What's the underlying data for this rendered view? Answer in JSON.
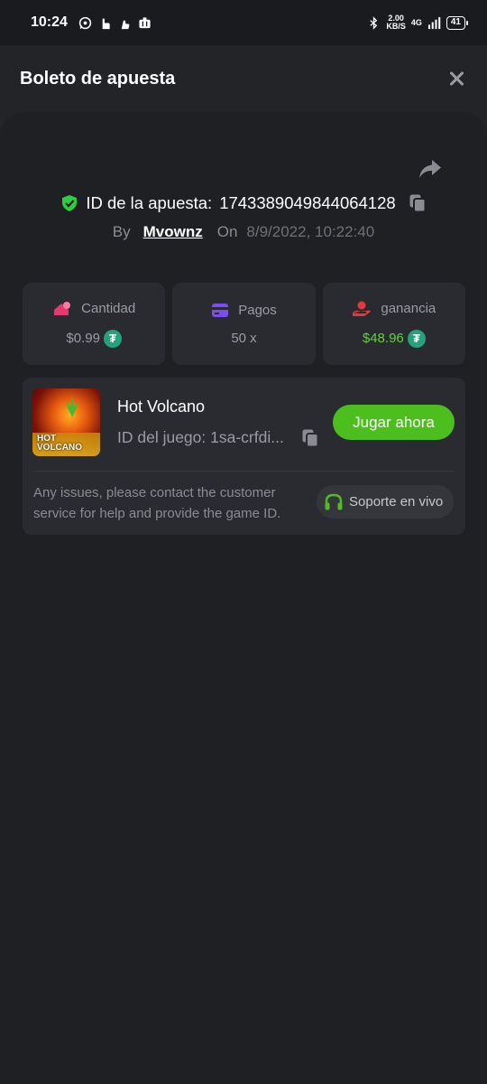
{
  "status_bar": {
    "time": "10:24",
    "net_speed_value": "2.00",
    "net_speed_unit": "KB/S",
    "network": "4G",
    "battery": "41"
  },
  "header": {
    "title": "Boleto de apuesta"
  },
  "bet": {
    "id_label": "ID de la apuesta:",
    "id_value": "1743389049844064128",
    "by_label": "By",
    "username": "Mvownz",
    "on_label": "On",
    "date": "8/9/2022, 10:22:40"
  },
  "stats": [
    {
      "label": "Cantidad",
      "value": "$0.99",
      "icon": "bet-amount-icon",
      "color": "#e03a6e"
    },
    {
      "label": "Pagos",
      "value": "50 x",
      "icon": "wallet-icon",
      "color": "#7b4cf0"
    },
    {
      "label": "ganancia",
      "value": "$48.96",
      "icon": "profit-icon",
      "color": "#e03a3a"
    }
  ],
  "usdt_symbol": "₮",
  "game": {
    "name": "Hot Volcano",
    "id_text": "ID del juego: 1sa-crfdi...",
    "thumb_line1": "HOT",
    "thumb_line2": "VOLCANO",
    "play_label": "Jugar ahora",
    "help_text": "Any issues, please contact the customer service for help and provide the game ID.",
    "support_label": "Soporte en vivo"
  },
  "colors": {
    "accent_green": "#4cbf1f",
    "profit_green": "#5fd13a",
    "shield_green": "#2ecc40",
    "usdt": "#26a17b"
  }
}
